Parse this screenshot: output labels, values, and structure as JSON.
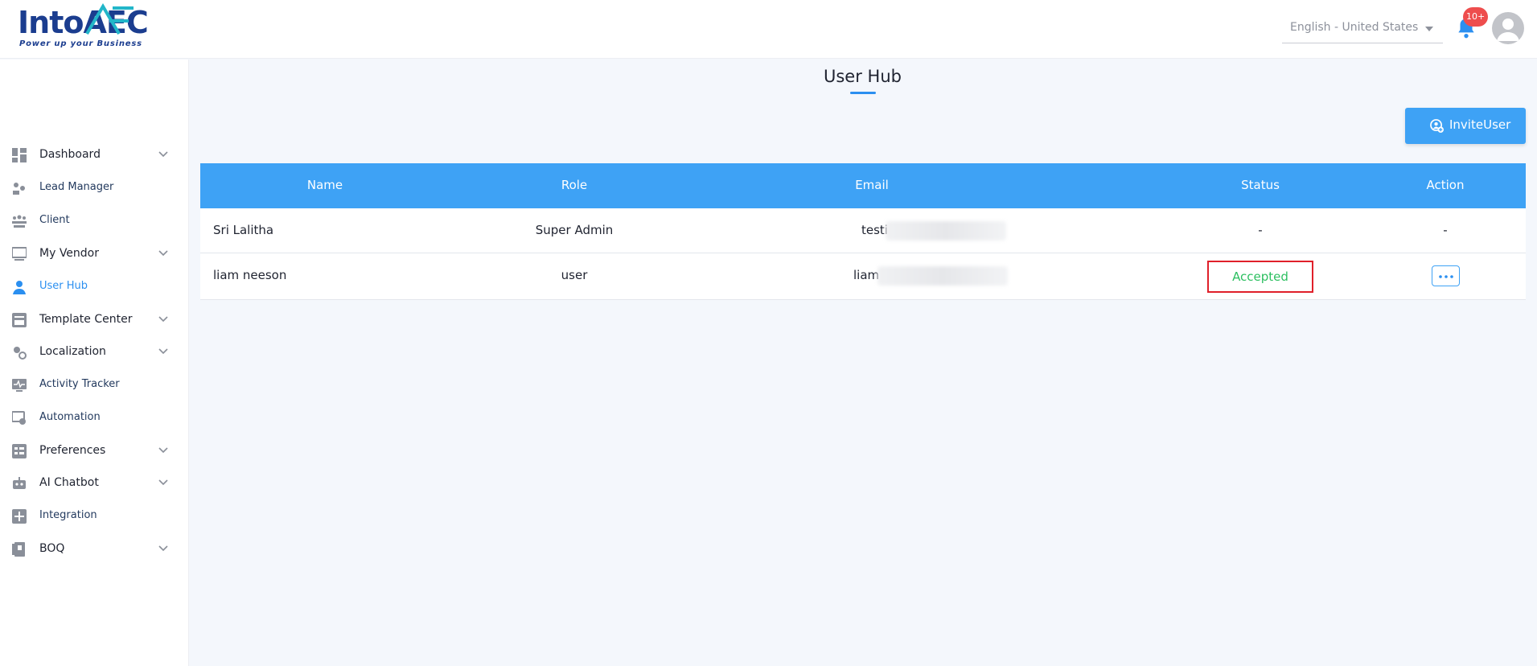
{
  "header": {
    "logo_text": "IntoAEC",
    "logo_tagline": "Power up your Business",
    "language": "English - United States",
    "notification_badge": "10+"
  },
  "sidebar": {
    "items": [
      {
        "label": "Dashboard",
        "icon": "dashboard-icon",
        "expandable": true
      },
      {
        "label": "Lead Manager",
        "icon": "lead-manager-icon",
        "expandable": false
      },
      {
        "label": "Client",
        "icon": "client-icon",
        "expandable": false
      },
      {
        "label": "My Vendor",
        "icon": "vendor-icon",
        "expandable": true
      },
      {
        "label": "User Hub",
        "icon": "user-icon",
        "expandable": false,
        "active": true
      },
      {
        "label": "Template Center",
        "icon": "template-icon",
        "expandable": true
      },
      {
        "label": "Localization",
        "icon": "localization-icon",
        "expandable": true
      },
      {
        "label": "Activity Tracker",
        "icon": "activity-icon",
        "expandable": false
      },
      {
        "label": "Automation",
        "icon": "automation-icon",
        "expandable": false
      },
      {
        "label": "Preferences",
        "icon": "preferences-icon",
        "expandable": true
      },
      {
        "label": "AI Chatbot",
        "icon": "chatbot-icon",
        "expandable": true
      },
      {
        "label": "Integration",
        "icon": "integration-icon",
        "expandable": false
      },
      {
        "label": "BOQ",
        "icon": "boq-icon",
        "expandable": true
      }
    ]
  },
  "main": {
    "title": "User Hub",
    "invite_label": "InviteUser",
    "table": {
      "headers": [
        "Name",
        "Role",
        "Email",
        "Status",
        "Action"
      ],
      "rows": [
        {
          "name": "Sri Lalitha",
          "role": "Super Admin",
          "email": "testi",
          "status": "-",
          "action": "-"
        },
        {
          "name": "liam neeson",
          "role": "user",
          "email": "liam",
          "status": "Accepted",
          "action": "more"
        }
      ]
    }
  },
  "colors": {
    "accent": "#3ea2f5",
    "active_nav": "#2b8ff0",
    "status_accepted": "#2cbf60",
    "highlight_border": "#e0202a",
    "badge": "#ee4d4d"
  }
}
